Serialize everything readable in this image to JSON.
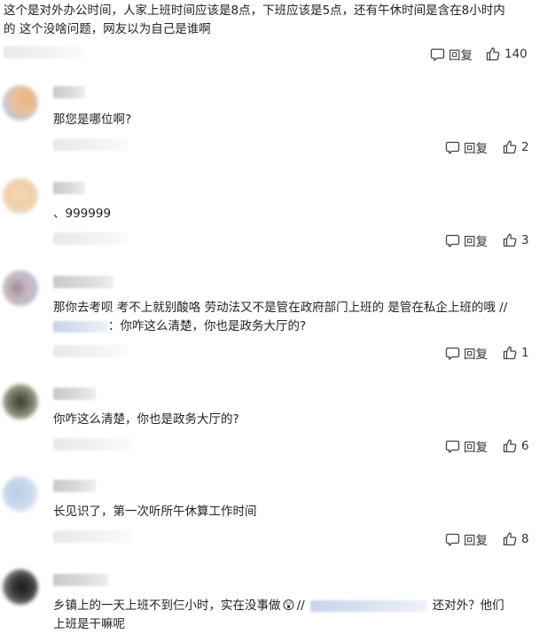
{
  "top_comment": {
    "text_line1": "这个是对外办公时间，人家上班时间应该是8点，下班应该是5点，还有午休时间是含在8小时内",
    "text_line2": "的 这个没啥问题，网友以为自己是谁啊",
    "reply_label": "回复",
    "likes": "140"
  },
  "replies": [
    {
      "text": "那您是哪位啊?",
      "reply_label": "回复",
      "likes": "2"
    },
    {
      "text": "、999999",
      "reply_label": "回复",
      "likes": "3"
    },
    {
      "text_line1": "那你去考呗 考不上就别酸咯 劳动法又不是管在政府部门上班的 是管在私企上班的哦 //",
      "text_line2_suffix": "：你咋这么清楚，你也是政务大厅的?",
      "reply_label": "回复",
      "likes": "1"
    },
    {
      "text": "你咋这么清楚，你也是政务大厅的?",
      "reply_label": "回复",
      "likes": "6"
    },
    {
      "text": "长见识了，第一次听所午休算工作时间",
      "reply_label": "回复",
      "likes": "8"
    },
    {
      "text_line1_a": "乡镇上的一天上班不到仨小时，实在没事做",
      "emoji": "😲",
      "text_line1_b": "//",
      "text_line1_c": "还对外？他们",
      "text_line2": "上班是干嘛呢"
    }
  ],
  "icons": {
    "reply": "comment-bubble-icon",
    "like": "thumbs-up-icon"
  }
}
